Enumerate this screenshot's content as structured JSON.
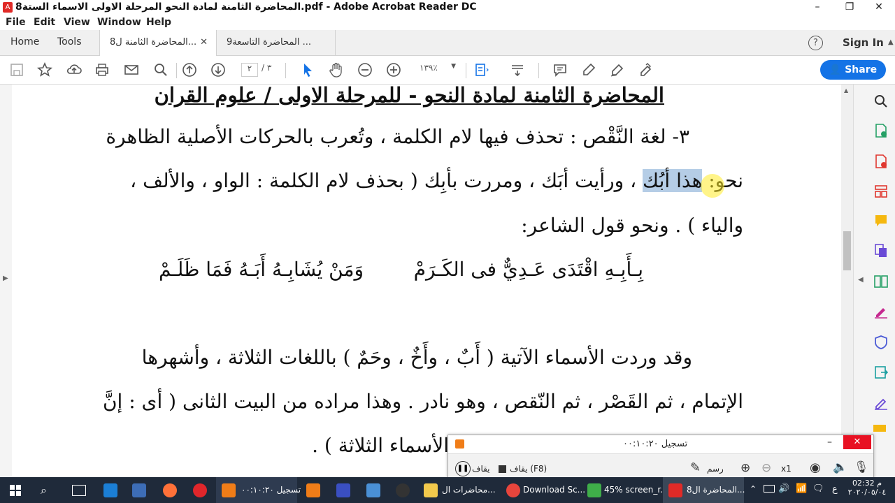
{
  "window": {
    "title": "8المحاضرة الثامنة لمادة النحو المرحلة الاولى الاسماء الستة.pdf - Adobe Acrobat Reader DC",
    "minimize": "–",
    "restore": "❐",
    "close": "✕"
  },
  "menu": [
    "File",
    "Edit",
    "View",
    "Window",
    "Help"
  ],
  "tabs": {
    "home": "Home",
    "tools": "Tools",
    "doc1": "8المحاضرة الثامنة ل...",
    "doc2": "9المحاضرة التاسعة ...",
    "help": "?",
    "signin": "Sign In"
  },
  "toolbar": {
    "page_current": "٢",
    "page_total": "/ ٣",
    "zoom": "١٣٩٪",
    "share": "Share"
  },
  "document": {
    "heading": "المحاضرة الثامنة لمادة النحو - للمرحلة الاولى / علوم القران",
    "line1": "٣- لغة النَّقْص : تحذف فيها لام الكلمة ، وتُعرب بالحركات الأصلية الظاهرة",
    "line2_a": "نحو:",
    "line2_hl": "هذا أبُك",
    "line2_b": "، ورأيت أبَك ، ومررت بأبِك ( بحذف لام الكلمة : الواو ، والألف ،",
    "line3": "والياء ) . ونحو قول الشاعر:",
    "verse_right": "بِـأَبِـهِ  اقْتَدَى عَـدِيٌّ فى الكَـرَمْ",
    "verse_left": "وَمَنْ يُشَابِـهُ أَبَـهُ فَمَا ظَلَـمْ",
    "line4": "وقد وردت الأسماء الآتية ( أَبٌ ، وأَخٌ ، وحَمٌ ) باللغات الثلاثة ، وأشهرها",
    "line5": "الإتمام ، ثم القَصْر ، ثم النّقص ، وهو نادر . وهذا مراده من البيت الثانى ( أى : إنَّ",
    "line6": "الأسماء الثلاثة ) ."
  },
  "recorder": {
    "title": "تسجيل ٠٠:١٠:٢٠",
    "draw": "رسم",
    "zoom": "x1",
    "stop": "يقاف (F8)",
    "pause": "يقاف"
  },
  "taskbar": {
    "items": [
      "تسجيل ٠٠:١٠:٢٠",
      "محاضرات ال...",
      "Download Sc...",
      "45% screen_r...",
      "8المحاضرة ال..."
    ],
    "lang": "ع",
    "time": "02:32 م",
    "date": "٢٠٢٠/٠٥/٠٤"
  },
  "colors": {
    "accent": "#1473e6",
    "highlight": "#b5cde6",
    "taskbar": "#1f2a3a",
    "close_red": "#e81123"
  }
}
